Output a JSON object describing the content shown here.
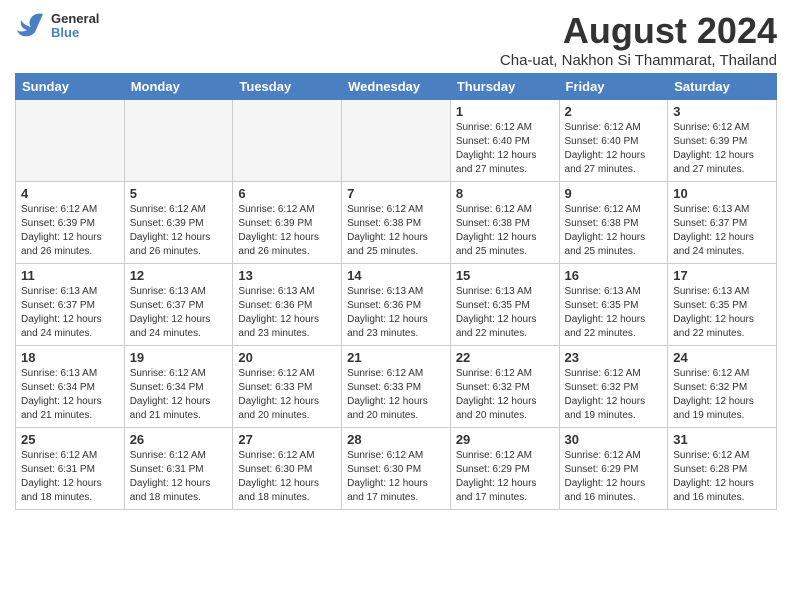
{
  "logo": {
    "general": "General",
    "blue": "Blue"
  },
  "title": "August 2024",
  "subtitle": "Cha-uat, Nakhon Si Thammarat, Thailand",
  "days_header": [
    "Sunday",
    "Monday",
    "Tuesday",
    "Wednesday",
    "Thursday",
    "Friday",
    "Saturday"
  ],
  "weeks": [
    [
      {
        "day": "",
        "empty": true
      },
      {
        "day": "",
        "empty": true
      },
      {
        "day": "",
        "empty": true
      },
      {
        "day": "",
        "empty": true
      },
      {
        "day": "1",
        "sunrise": "6:12 AM",
        "sunset": "6:40 PM",
        "daylight": "12 hours and 27 minutes."
      },
      {
        "day": "2",
        "sunrise": "6:12 AM",
        "sunset": "6:40 PM",
        "daylight": "12 hours and 27 minutes."
      },
      {
        "day": "3",
        "sunrise": "6:12 AM",
        "sunset": "6:39 PM",
        "daylight": "12 hours and 27 minutes."
      }
    ],
    [
      {
        "day": "4",
        "sunrise": "6:12 AM",
        "sunset": "6:39 PM",
        "daylight": "12 hours and 26 minutes."
      },
      {
        "day": "5",
        "sunrise": "6:12 AM",
        "sunset": "6:39 PM",
        "daylight": "12 hours and 26 minutes."
      },
      {
        "day": "6",
        "sunrise": "6:12 AM",
        "sunset": "6:39 PM",
        "daylight": "12 hours and 26 minutes."
      },
      {
        "day": "7",
        "sunrise": "6:12 AM",
        "sunset": "6:38 PM",
        "daylight": "12 hours and 25 minutes."
      },
      {
        "day": "8",
        "sunrise": "6:12 AM",
        "sunset": "6:38 PM",
        "daylight": "12 hours and 25 minutes."
      },
      {
        "day": "9",
        "sunrise": "6:12 AM",
        "sunset": "6:38 PM",
        "daylight": "12 hours and 25 minutes."
      },
      {
        "day": "10",
        "sunrise": "6:13 AM",
        "sunset": "6:37 PM",
        "daylight": "12 hours and 24 minutes."
      }
    ],
    [
      {
        "day": "11",
        "sunrise": "6:13 AM",
        "sunset": "6:37 PM",
        "daylight": "12 hours and 24 minutes."
      },
      {
        "day": "12",
        "sunrise": "6:13 AM",
        "sunset": "6:37 PM",
        "daylight": "12 hours and 24 minutes."
      },
      {
        "day": "13",
        "sunrise": "6:13 AM",
        "sunset": "6:36 PM",
        "daylight": "12 hours and 23 minutes."
      },
      {
        "day": "14",
        "sunrise": "6:13 AM",
        "sunset": "6:36 PM",
        "daylight": "12 hours and 23 minutes."
      },
      {
        "day": "15",
        "sunrise": "6:13 AM",
        "sunset": "6:35 PM",
        "daylight": "12 hours and 22 minutes."
      },
      {
        "day": "16",
        "sunrise": "6:13 AM",
        "sunset": "6:35 PM",
        "daylight": "12 hours and 22 minutes."
      },
      {
        "day": "17",
        "sunrise": "6:13 AM",
        "sunset": "6:35 PM",
        "daylight": "12 hours and 22 minutes."
      }
    ],
    [
      {
        "day": "18",
        "sunrise": "6:13 AM",
        "sunset": "6:34 PM",
        "daylight": "12 hours and 21 minutes."
      },
      {
        "day": "19",
        "sunrise": "6:12 AM",
        "sunset": "6:34 PM",
        "daylight": "12 hours and 21 minutes."
      },
      {
        "day": "20",
        "sunrise": "6:12 AM",
        "sunset": "6:33 PM",
        "daylight": "12 hours and 20 minutes."
      },
      {
        "day": "21",
        "sunrise": "6:12 AM",
        "sunset": "6:33 PM",
        "daylight": "12 hours and 20 minutes."
      },
      {
        "day": "22",
        "sunrise": "6:12 AM",
        "sunset": "6:32 PM",
        "daylight": "12 hours and 20 minutes."
      },
      {
        "day": "23",
        "sunrise": "6:12 AM",
        "sunset": "6:32 PM",
        "daylight": "12 hours and 19 minutes."
      },
      {
        "day": "24",
        "sunrise": "6:12 AM",
        "sunset": "6:32 PM",
        "daylight": "12 hours and 19 minutes."
      }
    ],
    [
      {
        "day": "25",
        "sunrise": "6:12 AM",
        "sunset": "6:31 PM",
        "daylight": "12 hours and 18 minutes."
      },
      {
        "day": "26",
        "sunrise": "6:12 AM",
        "sunset": "6:31 PM",
        "daylight": "12 hours and 18 minutes."
      },
      {
        "day": "27",
        "sunrise": "6:12 AM",
        "sunset": "6:30 PM",
        "daylight": "12 hours and 18 minutes."
      },
      {
        "day": "28",
        "sunrise": "6:12 AM",
        "sunset": "6:30 PM",
        "daylight": "12 hours and 17 minutes."
      },
      {
        "day": "29",
        "sunrise": "6:12 AM",
        "sunset": "6:29 PM",
        "daylight": "12 hours and 17 minutes."
      },
      {
        "day": "30",
        "sunrise": "6:12 AM",
        "sunset": "6:29 PM",
        "daylight": "12 hours and 16 minutes."
      },
      {
        "day": "31",
        "sunrise": "6:12 AM",
        "sunset": "6:28 PM",
        "daylight": "12 hours and 16 minutes."
      }
    ]
  ]
}
